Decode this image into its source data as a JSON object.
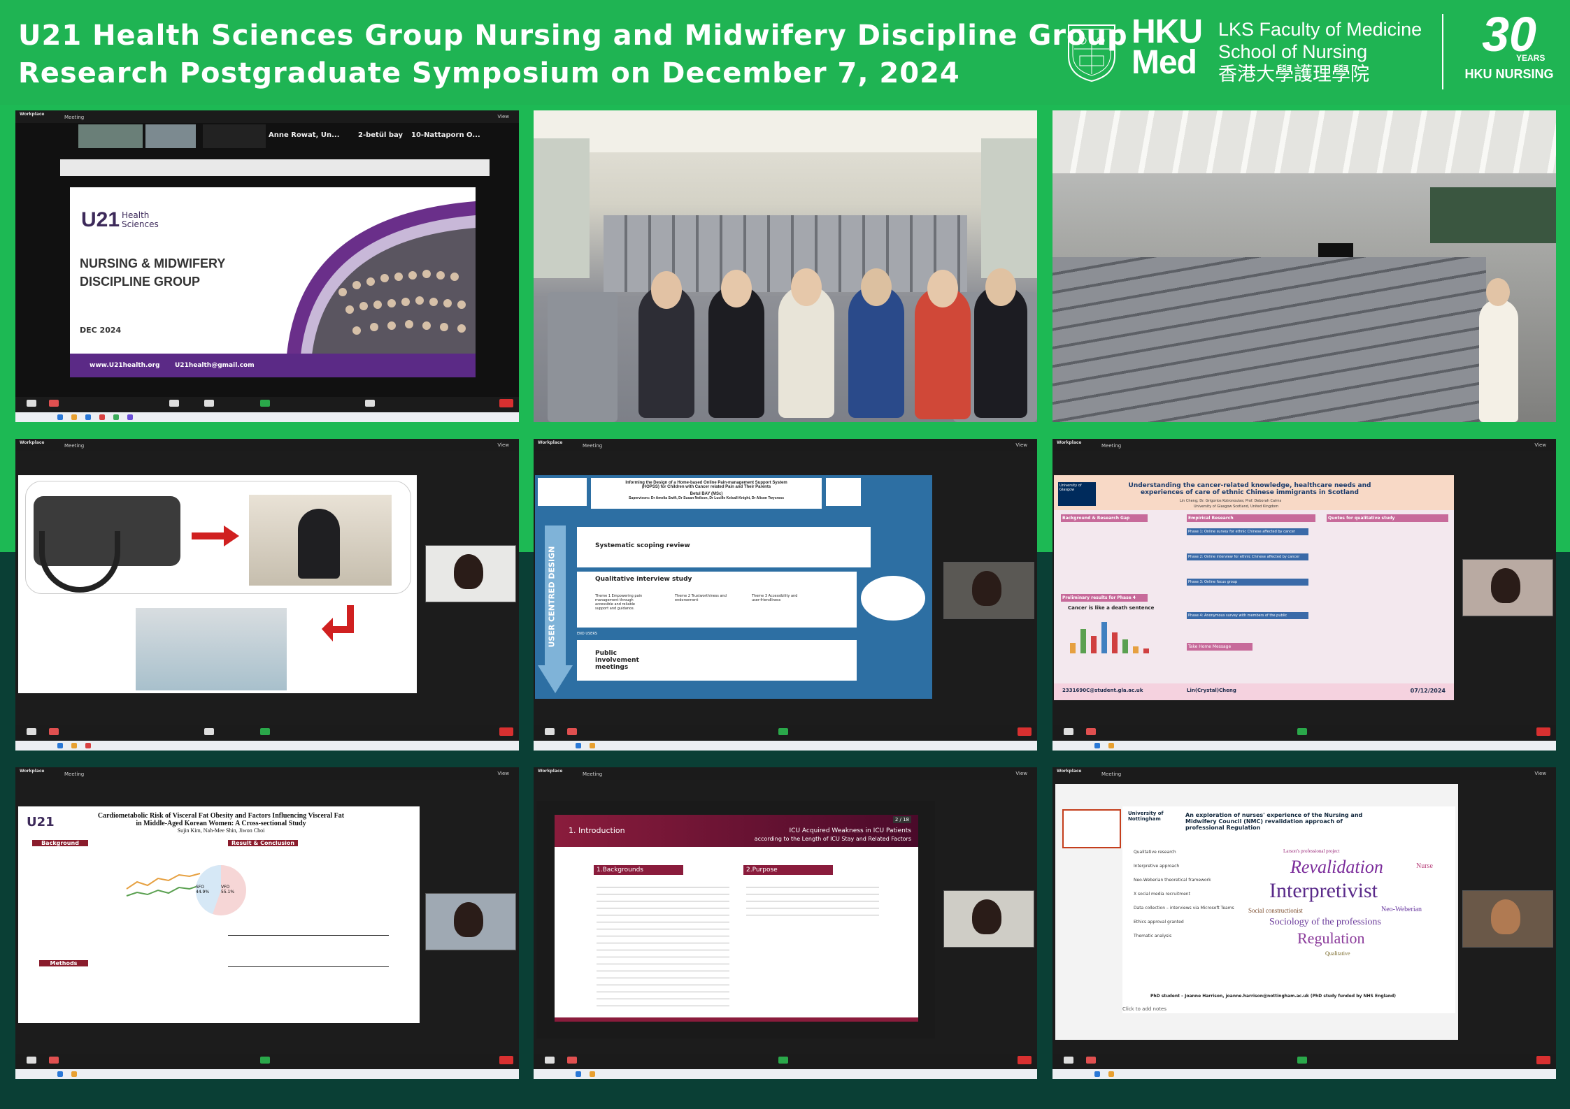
{
  "header": {
    "title_line1": "U21 Health Sciences Group Nursing and Midwifery Discipline Group",
    "title_line2": "Research Postgraduate Symposium on December 7, 2024",
    "logo_hku": "HKU",
    "logo_med": "Med",
    "faculty_line1": "LKS Faculty of Medicine",
    "faculty_line2": "School of Nursing",
    "faculty_line3": "香港大學護理學院",
    "anniv_number": "30",
    "anniv_years": "YEARS",
    "anniv_label": "HKU NURSING"
  },
  "zoom": {
    "app_name": "Workplace",
    "meeting_label": "Meeting",
    "view_label": "View"
  },
  "panel1": {
    "participants": [
      "Anne Rowat, Un...",
      "2-betül bay",
      "10-Nattaporn O..."
    ],
    "slide_logo_main": "U21",
    "slide_logo_sub1": "Health",
    "slide_logo_sub2": "Sciences",
    "slide_title1": "NURSING & MIDWIFERY",
    "slide_title2": "DISCIPLINE GROUP",
    "slide_date": "DEC 2024",
    "footer_web": "www.U21health.org",
    "footer_email": "U21health@gmail.com"
  },
  "panel5": {
    "title1": "Informing the Design of a Home-based Online Pain-management Support System",
    "title2": "(HOPSS) for Children with Cancer related Pain and Their Parents",
    "presenter": "Betul BAY (MSc)",
    "supervisors": "Supervisors: Dr Amelia Swift, Dr Susan Neilson, Dr Lucille Kelsall-Knight, Dr Alison Twycross",
    "vertical": "USER CENTRED DESIGN",
    "section1": "Systematic scoping review",
    "section2": "Qualitative interview study",
    "section3": "Public involvement meetings",
    "end_users": "END USERS",
    "theme1": "Theme 1 Empowering pain management through accessible and reliable support and guidance.",
    "theme2": "Theme 2 Trustworthiness and endorsement",
    "theme3": "Theme 3 Accessibility and user-friendliness"
  },
  "panel6": {
    "university": "University of Glasgow",
    "title": "Understanding the cancer-related knowledge, healthcare needs and experiences of care of ethnic Chinese immigrants in Scotland",
    "authors": "Lin Cheng; Dr. Grigorios Kotronoulas; Prof. Deborah Cairns",
    "affil": "University of Glasgow Scotland, United Kingdom",
    "box_bg": "Background & Research Gap",
    "box_emp": "Empirical Research",
    "box_quotes": "Quotes for qualitative study",
    "box_prelim": "Preliminary results for Phase 4",
    "phase1": "Phase 1: Online survey for ethnic Chinese affected by cancer",
    "phase2": "Phase 2: Online interview for ethnic Chinese affected by cancer",
    "phase3": "Phase 3: Online focus group",
    "phase4": "Phase 4: Anonymous survey with members of the public",
    "chart_title": "Cancer is like a death sentence",
    "takehome": "Take Home Message",
    "email": "2331690C@student.gla.ac.uk",
    "handle": "Lin(Crystal)Cheng",
    "date": "07/12/2024"
  },
  "panel7": {
    "logo": "U21",
    "title1": "Cardiometabolic Risk of Visceral Fat Obesity and Factors Influencing Visceral Fat",
    "title2": "in Middle-Aged Korean Women: A Cross-sectional Study",
    "authors": "Sujin Kim, Nah-Mee Shin, Jiwon Choi",
    "background": "Background",
    "result": "Result & Conclusion",
    "methods": "Methods",
    "sfo": "SFO 44.9%",
    "vfo": "VFO 55.1%"
  },
  "panel8": {
    "section": "1. Introduction",
    "title1": "ICU Acquired Weakness in ICU Patients",
    "title2": "according to the Length of ICU Stay and Related Factors",
    "page": "2 / 18",
    "backgrounds": "1.Backgrounds",
    "purpose": "2.Purpose"
  },
  "panel9": {
    "university": "University of Nottingham",
    "title": "An exploration of nurses' experience of the Nursing and Midwifery Council (NMC) revalidation approach of professional Regulation",
    "items": [
      "Qualitative research",
      "Interpretive approach",
      "Neo-Weberian theoretical framework",
      "X social media recruitment",
      "Data collection – interviews via Microsoft Teams",
      "Ethics approval granted",
      "Thematic analysis"
    ],
    "words": [
      "Revalidation",
      "Interpretivist",
      "Regulation",
      "Sociology of the professions",
      "Nurse",
      "Neo-Weberian",
      "Social constructionist",
      "Qualitative",
      "Larson's professional project"
    ],
    "footer": "PhD student – Joanne Harrison, joanne.harrison@nottingham.ac.uk (PhD study funded by NHS England)",
    "notes": "Click to add notes"
  }
}
